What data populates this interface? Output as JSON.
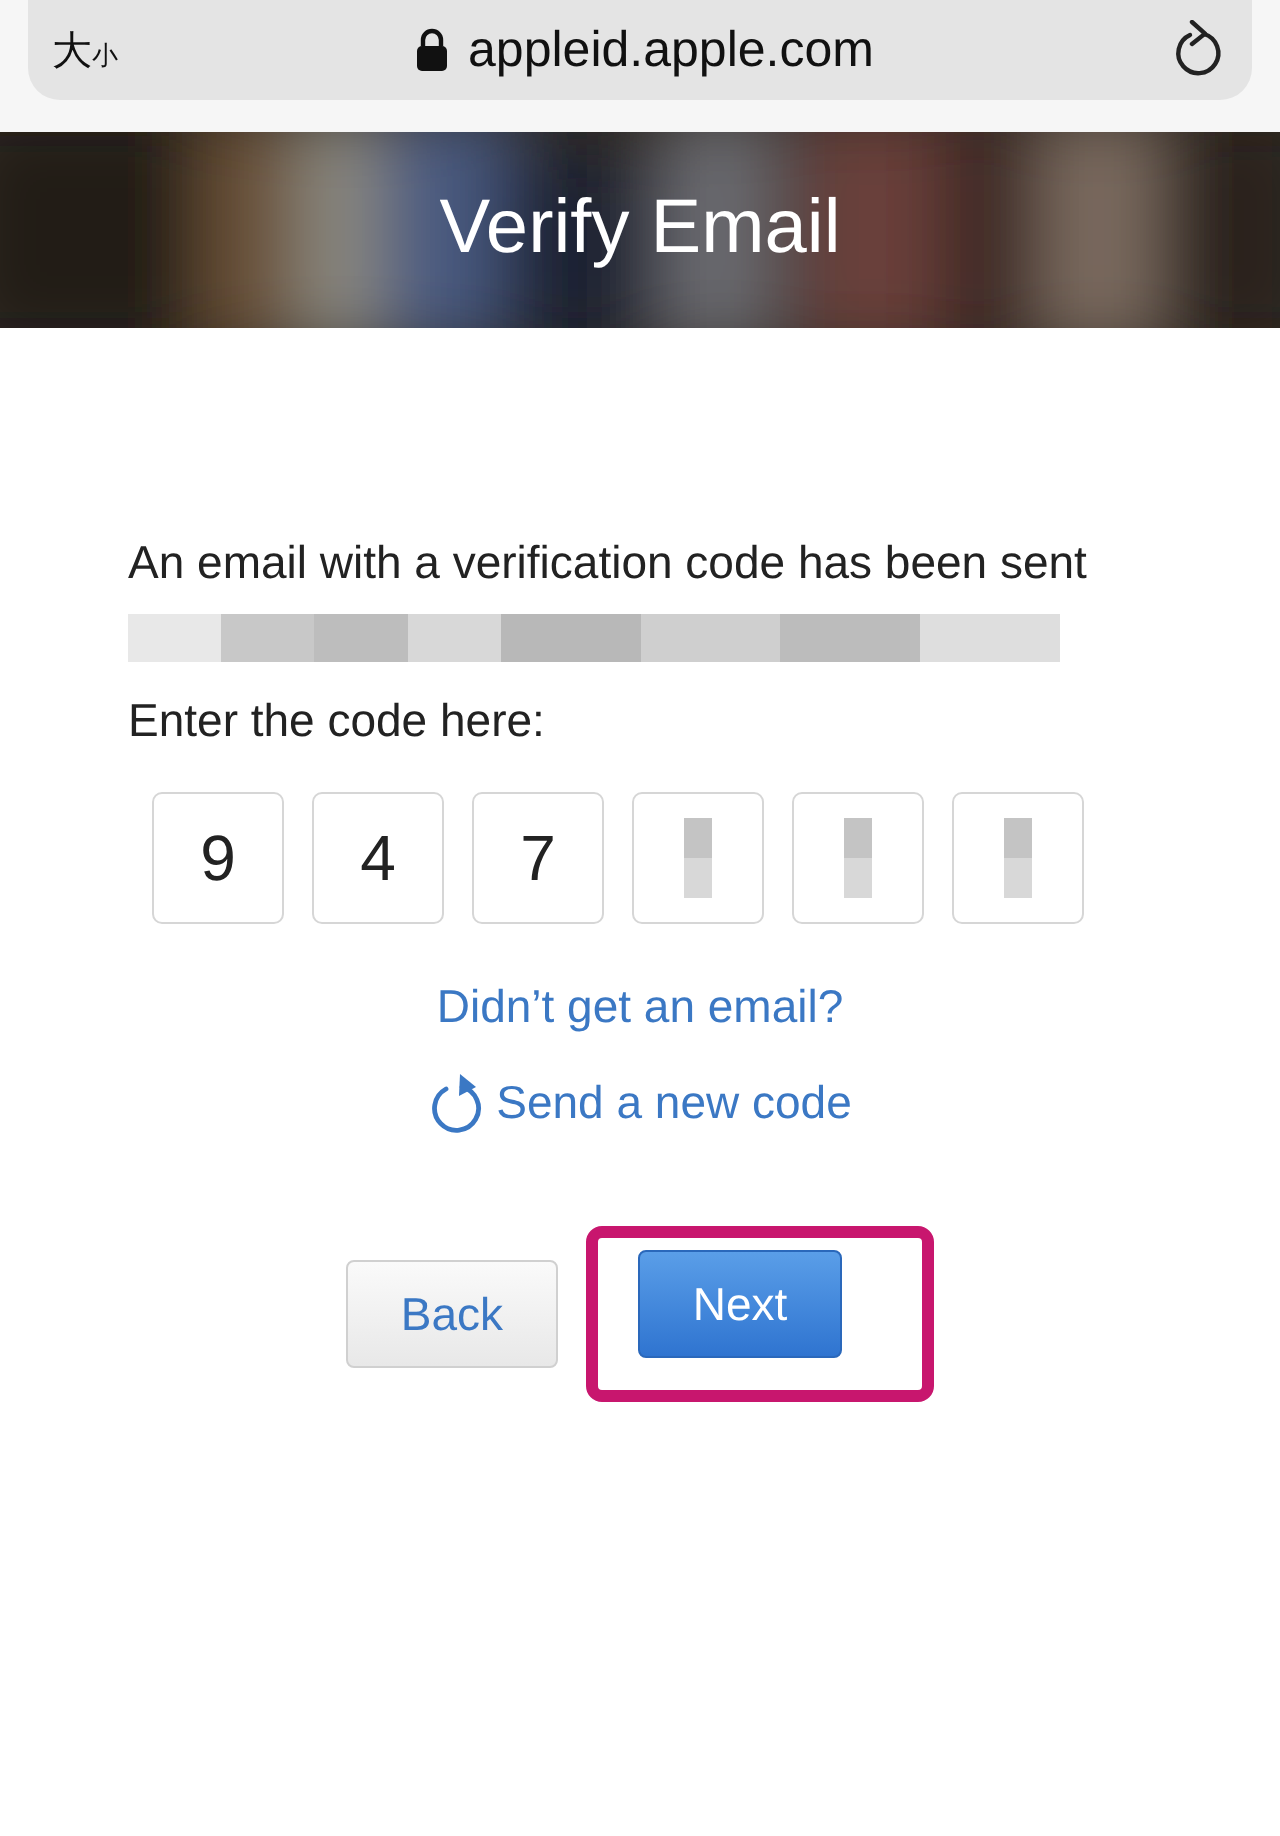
{
  "browser": {
    "text_size": {
      "large": "大",
      "small": "小"
    },
    "url": "appleid.apple.com"
  },
  "header": {
    "title": "Verify Email"
  },
  "message": {
    "text": "An email with a verification code has been sent",
    "prompt": "Enter the code here:"
  },
  "code": [
    {
      "kind": "digit",
      "value": "9"
    },
    {
      "kind": "digit",
      "value": "4"
    },
    {
      "kind": "digit",
      "value": "7"
    },
    {
      "kind": "redacted"
    },
    {
      "kind": "redacted"
    },
    {
      "kind": "redacted"
    }
  ],
  "help_link": "Didn’t get an email?",
  "resend_link": "Send a new code",
  "buttons": [
    {
      "label": "Back",
      "kind": "secondary",
      "highlighted": false
    },
    {
      "label": "Next",
      "kind": "primary",
      "highlighted": true
    }
  ]
}
